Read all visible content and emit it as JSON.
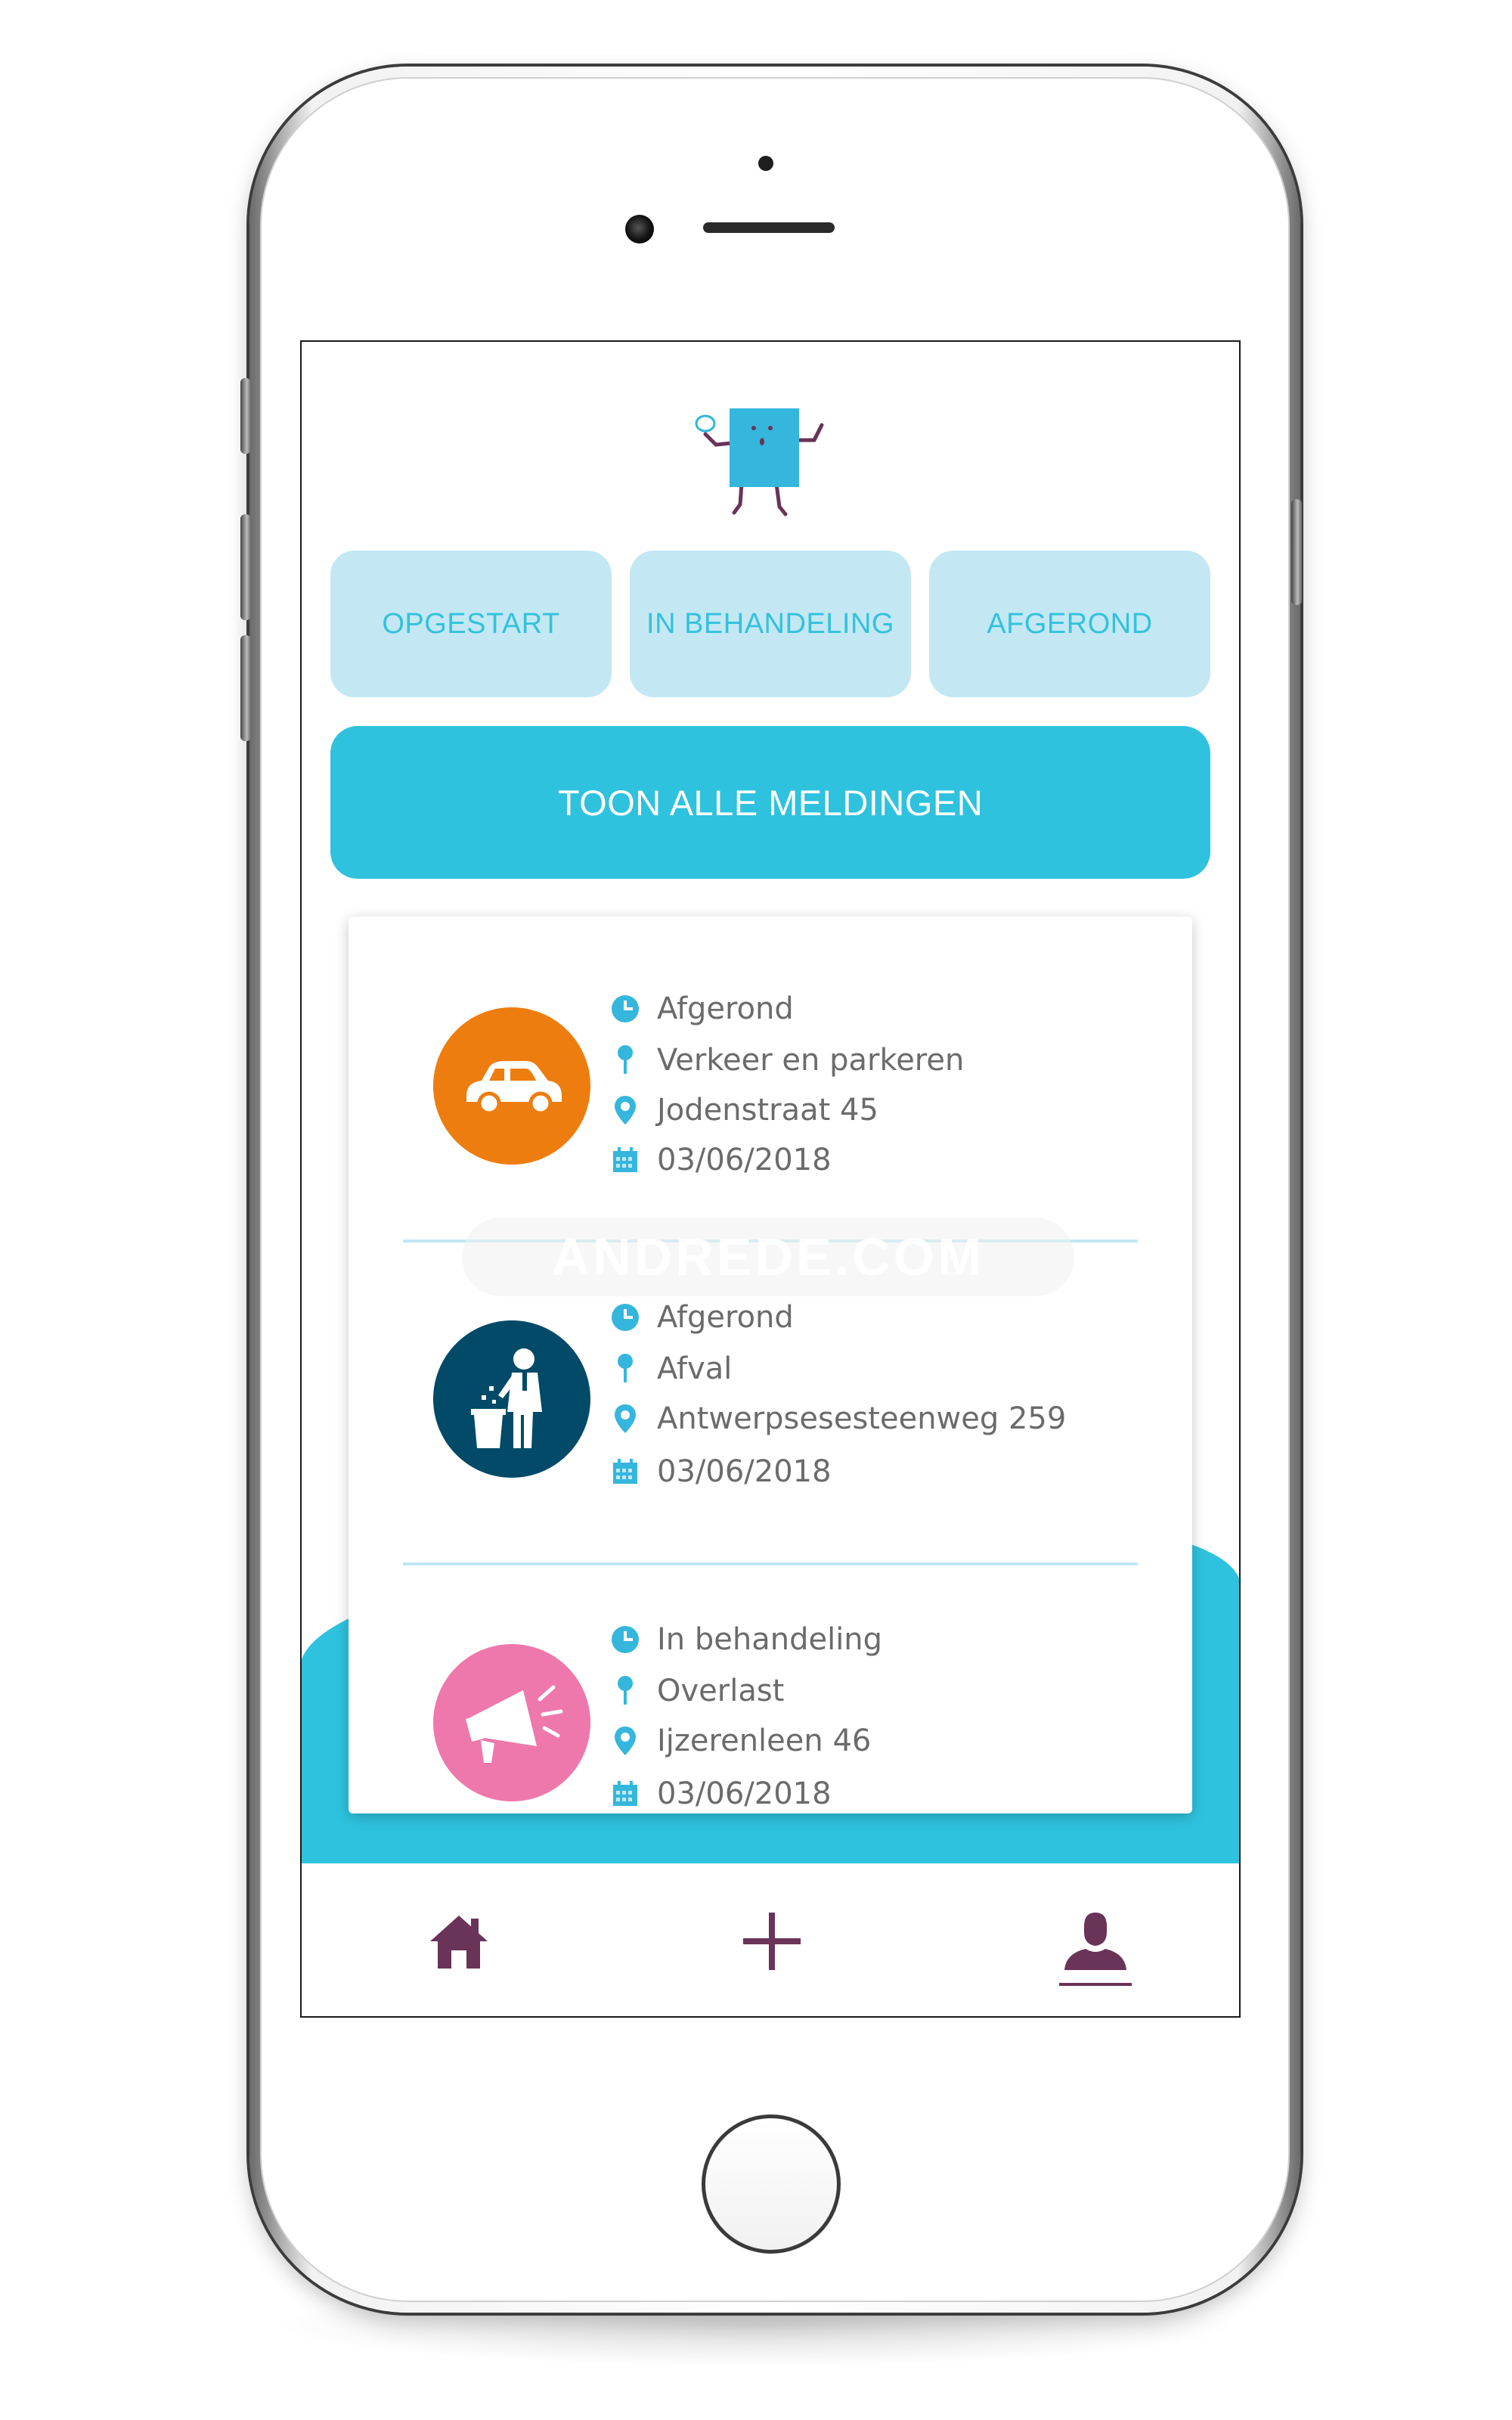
{
  "status_filters": [
    "OPGESTART",
    "IN BEHANDELING",
    "AFGEROND"
  ],
  "show_all_label": "TOON ALLE MELDINGEN",
  "watermark": "ANDREDE.COM",
  "reports": [
    {
      "status": "Afgerond",
      "category": "Verkeer en parkeren",
      "address": "Jodenstraat 45",
      "date": "03/06/2018",
      "icon": "car-icon",
      "color": "#ee7d0f"
    },
    {
      "status": "Afgerond",
      "category": "Afval",
      "address": "Antwerpsesesteenweg 259",
      "date": "03/06/2018",
      "icon": "litter-icon",
      "color": "#034a68"
    },
    {
      "status": "In behandeling",
      "category": "Overlast",
      "address": "Ijzerenleen 46",
      "date": "03/06/2018",
      "icon": "megaphone-icon",
      "color": "#ee78ab"
    }
  ],
  "nav": {
    "items": [
      "home-icon",
      "add-icon",
      "profile-icon"
    ],
    "active": "profile-icon"
  },
  "colors": {
    "accent": "#2ec2de",
    "light_accent": "#c3e8f4",
    "nav_icon": "#6a3358",
    "text": "#6b6b6b"
  }
}
